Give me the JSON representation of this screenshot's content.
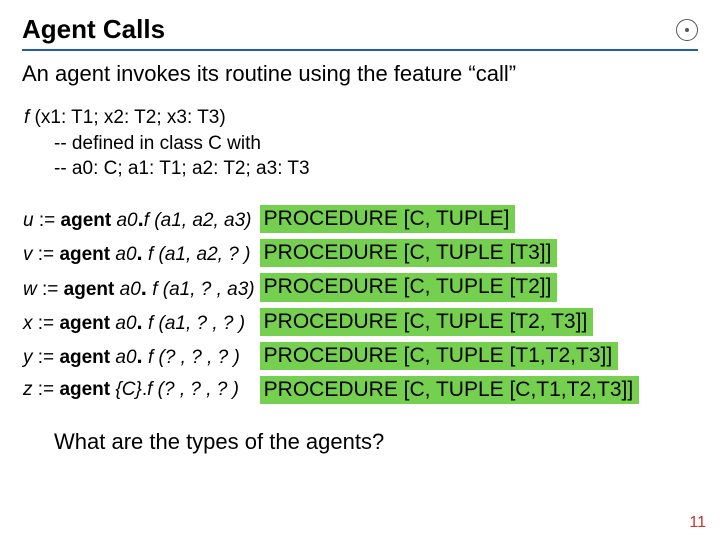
{
  "title": "Agent Calls",
  "intro": "An agent invokes its routine using the feature “call”",
  "sig": {
    "head_f": "f",
    "head_args": " (x1: T1; x2: T2; x3: T3)",
    "line2": "-- defined in class C with",
    "line3": "-- a0: C; a1: T1; a2: T2; a3: T3"
  },
  "rows": [
    {
      "var": "u",
      "assign": " := ",
      "kw": "agent",
      "tgt": "a0",
      "call": "f (a1, a2, a3)",
      "proc": "PROCEDURE [C, TUPLE]"
    },
    {
      "var": "v",
      "assign": " := ",
      "kw": "agent",
      "tgt": "a0",
      "call": "f (a1, a2, ? )",
      "proc": "PROCEDURE [C, TUPLE [T3]]"
    },
    {
      "var": "w",
      "assign": " := ",
      "kw": "agent",
      "tgt": "a0",
      "call": "f (a1, ? , a3)",
      "proc": "PROCEDURE [C, TUPLE [T2]]"
    },
    {
      "var": "x",
      "assign": " := ",
      "kw": "agent",
      "tgt": "a0",
      "call": "f (a1, ? , ? )",
      "proc": "PROCEDURE [C, TUPLE [T2, T3]]"
    },
    {
      "var": "y",
      "assign": " := ",
      "kw": "agent",
      "tgt": "a0",
      "call": "f (? , ? , ? )",
      "proc": "PROCEDURE [C, TUPLE [T1,T2,T3]]"
    },
    {
      "var": "z",
      "assign": " := ",
      "kw": "agent",
      "tgt": "{C}",
      "call": "f (? , ? , ? )",
      "proc": "PROCEDURE [C, TUPLE [C,T1,T2,T3]]"
    }
  ],
  "question": "What are the types of the agents?",
  "page": "11"
}
